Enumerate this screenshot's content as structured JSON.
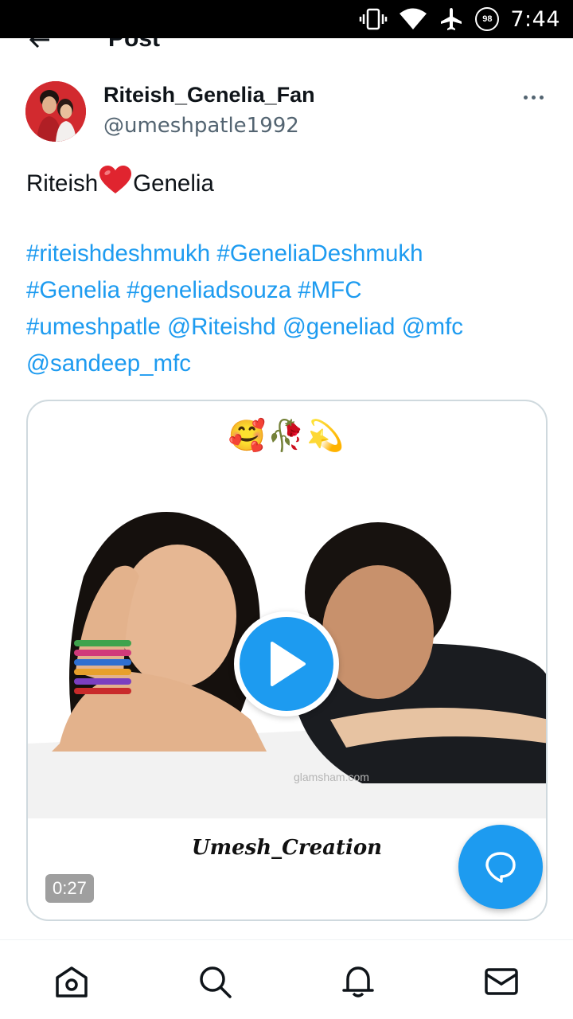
{
  "status_bar": {
    "time": "7:44",
    "battery": "98",
    "icons": [
      "vibrate-icon",
      "wifi-icon",
      "airplane-icon",
      "battery-icon"
    ]
  },
  "header": {
    "title": "Post",
    "back_icon": "arrow-left-icon"
  },
  "post": {
    "author": {
      "display_name": "Riteish_Genelia_Fan",
      "handle": "@umeshpatle1992"
    },
    "text_before": "Riteish",
    "text_emoji": "red-heart",
    "text_after": "Genelia",
    "tags": [
      "#riteishdeshmukh",
      "#GeneliaDeshmukh",
      "#Genelia",
      "#geneliadsouza",
      "#MFC",
      "#umeshpatle",
      "@Riteishd",
      "@geneliad",
      "@mfc",
      "@sandeep_mfc"
    ],
    "media": {
      "emoji": "🥰🥀💫",
      "watermark": "glamsham.com",
      "caption": "Umesh_Creation",
      "duration": "0:27"
    }
  },
  "colors": {
    "accent": "#1d9bf0",
    "text": "#0f1419",
    "secondary_text": "#536471",
    "border": "#cfd9de"
  },
  "bottom_nav": {
    "items": [
      "home-icon",
      "search-icon",
      "notifications-icon",
      "messages-icon"
    ]
  }
}
